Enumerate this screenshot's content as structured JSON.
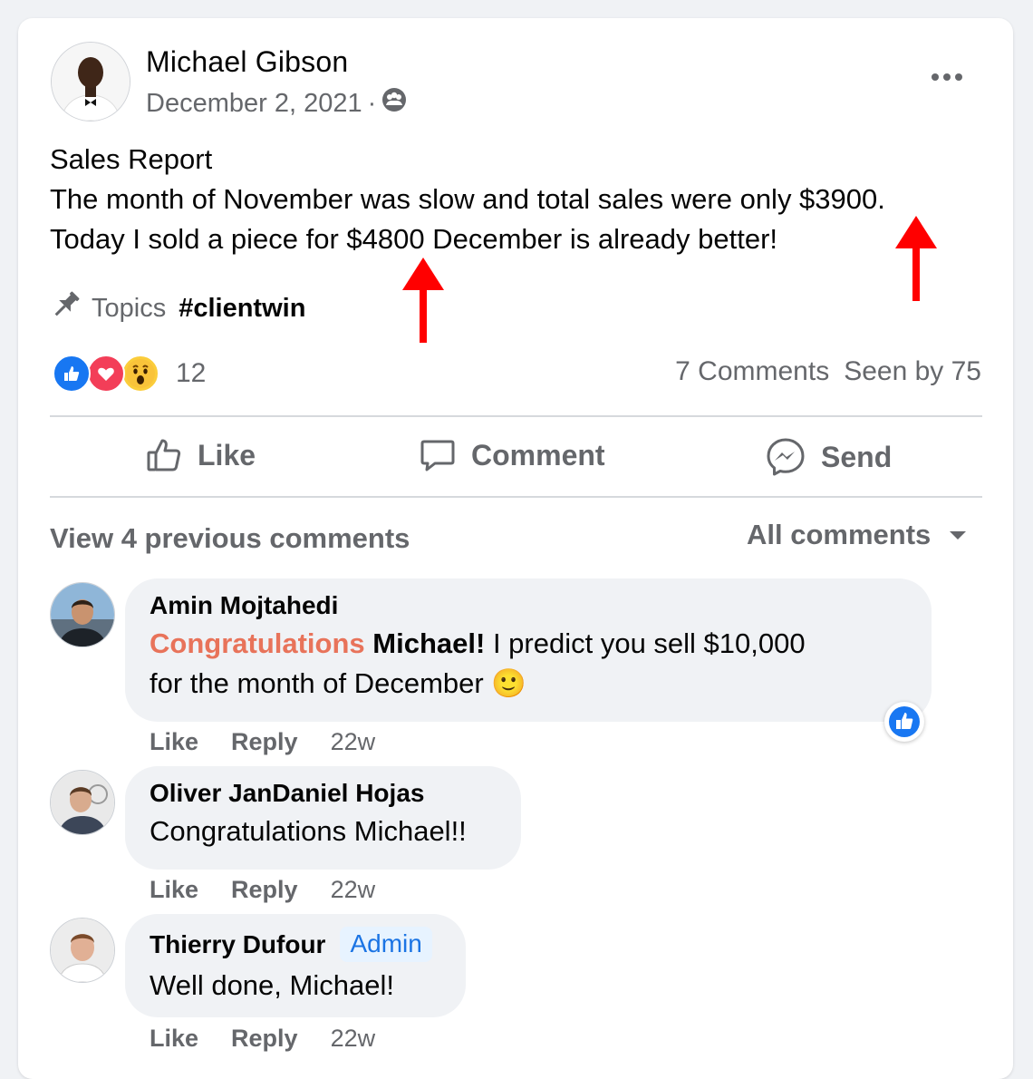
{
  "post": {
    "author": "Michael Gibson",
    "date": "December 2, 2021",
    "separator": "·",
    "privacy_icon": "group-icon",
    "more_icon": "more-icon",
    "lines": [
      "Sales Report",
      "The month of November was slow and total sales were only $3900.",
      "Today I sold a piece for $4800 December is already better!"
    ],
    "topics_label": "Topics",
    "topic_tag": "#clientwin",
    "reactions": [
      "like",
      "love",
      "wow"
    ],
    "reaction_count": "12",
    "comments_count": "7 Comments",
    "seen_by": "Seen by 75"
  },
  "actions": {
    "like": "Like",
    "comment": "Comment",
    "send": "Send"
  },
  "comments_section": {
    "view_previous": "View 4 previous comments",
    "filter": "All comments"
  },
  "comments": [
    {
      "name": "Amin Mojtahedi",
      "congrats": "Congratulations",
      "mention": "Michael!",
      "text_line1_rest": " I predict you sell $10,000",
      "text_line2": "for the month of December",
      "emoji": "🙂",
      "like": "Like",
      "reply": "Reply",
      "time": "22w"
    },
    {
      "name": "Oliver JanDaniel Hojas",
      "text": "Congratulations Michael!!",
      "like": "Like",
      "reply": "Reply",
      "time": "22w"
    },
    {
      "name": "Thierry Dufour",
      "badge": "Admin",
      "text": "Well done, Michael!",
      "like": "Like",
      "reply": "Reply",
      "time": "22w"
    }
  ],
  "colors": {
    "facebook_blue": "#1877f2",
    "love_red": "#f33e58",
    "annotation_red": "#ff0000",
    "secondary_text": "#65676b",
    "congrats_orange": "#e8735a"
  }
}
